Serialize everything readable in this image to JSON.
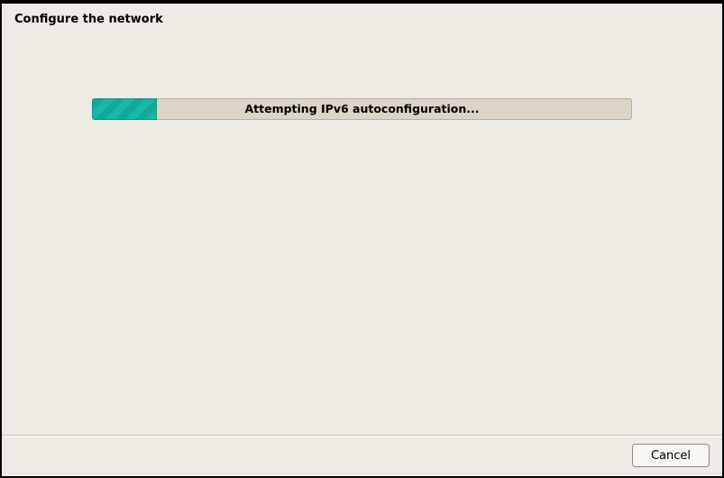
{
  "header": {
    "title": "Configure the network"
  },
  "progress": {
    "label": "Attempting IPv6 autoconfiguration...",
    "percent": 12,
    "fill_color": "#18b8a8",
    "track_color": "#ddd4c8"
  },
  "footer": {
    "cancel_label": "Cancel"
  }
}
